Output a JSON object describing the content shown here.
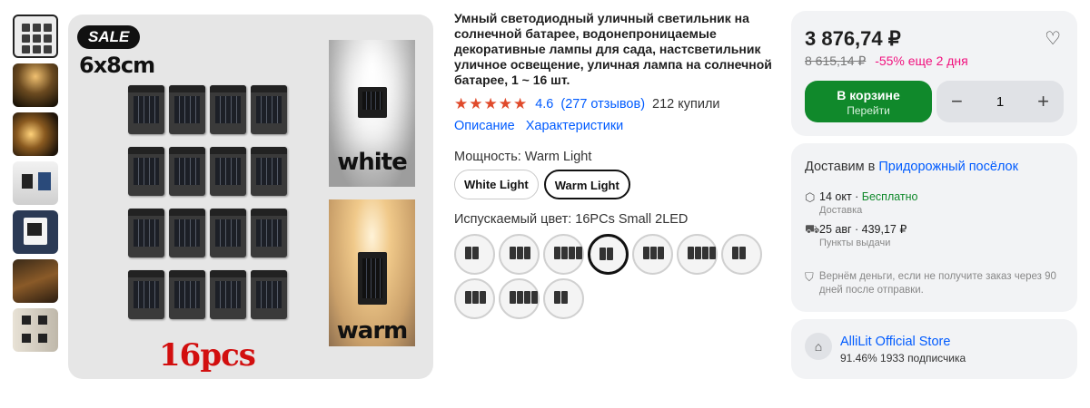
{
  "gallery": {
    "image_sale_badge": "SALE",
    "image_size_text": "6x8cm",
    "image_count_text": "16pcs",
    "image_white_label": "white",
    "image_warm_label": "warm"
  },
  "product": {
    "title": "Умный светодиодный уличный светильник на солнечной батарее, водонепроницаемые декоративные лампы для сада, настсветильник уличное освещение, уличная лампа на солнечной батарее, 1 ~ 16 шт.",
    "stars": "★★★★★",
    "rating": "4.6",
    "reviews": "(277 отзывов)",
    "bought": "212 купили",
    "link_description": "Описание",
    "link_specs": "Характеристики",
    "power_label": "Мощность: Warm Light",
    "power_options": [
      "White Light",
      "Warm Light"
    ],
    "color_label": "Испускаемый цвет: 16PCs Small 2LED"
  },
  "price_card": {
    "price": "3 876,74 ₽",
    "old_price": "8 615,14 ₽",
    "discount": "-55% еще 2 дня",
    "cart_label": "В корзине",
    "cart_sub": "Перейти",
    "minus": "−",
    "quantity": "1",
    "plus": "+"
  },
  "delivery": {
    "head_prefix": "Доставим в",
    "location": "Придорожный посёлок",
    "option1_date": "14 окт",
    "option1_price": "Бесплатно",
    "option1_sub": "Доставка",
    "option2_text": "25 авг · 439,17 ₽",
    "option2_sub": "Пункты выдачи",
    "refund_text": "Вернём деньги, если не получите заказ через 90 дней после отправки."
  },
  "store": {
    "name": "AlliLit Official Store",
    "meta": "91.46%   1933 подписчика"
  },
  "colors": {
    "accent_blue": "#005bff",
    "cart_green": "#10892b",
    "discount_pink": "#f1117e",
    "star_orange": "#e04a2b"
  }
}
